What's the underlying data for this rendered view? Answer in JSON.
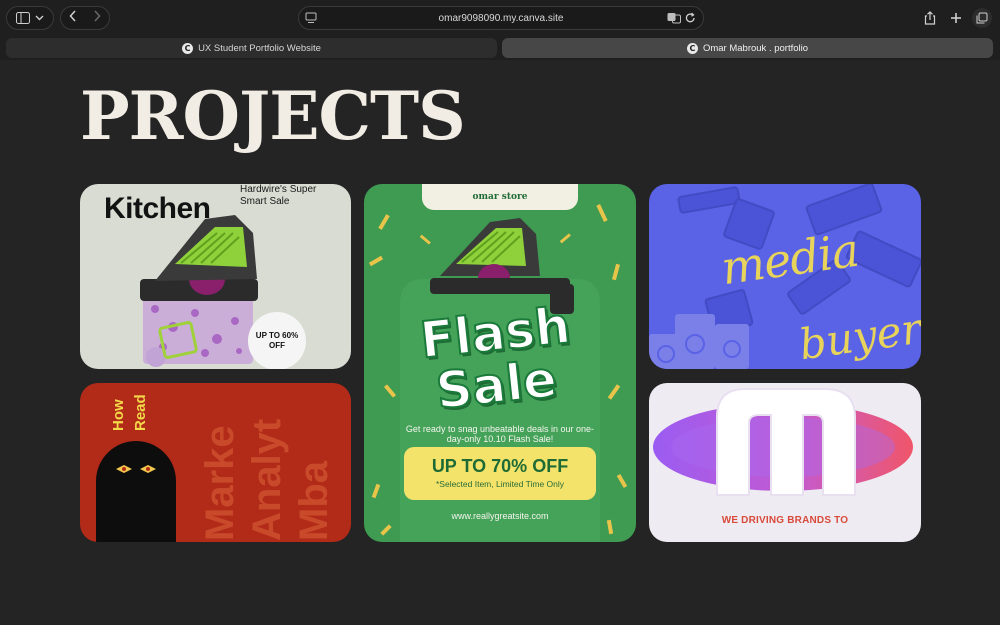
{
  "browser": {
    "url": "omar9098090.my.canva.site",
    "tabs": [
      {
        "label": "UX Student Portfolio Website",
        "active": false
      },
      {
        "label": "Omar Mabrouk . portfolio",
        "active": true
      }
    ]
  },
  "page": {
    "title": "PROJECTS"
  },
  "projects": {
    "kitchen": {
      "title": "Kitchen",
      "subtitle": "Hardwire's Super Smart Sale",
      "badge": "UP TO 60% OFF"
    },
    "howto": {
      "words_yellow": [
        "How",
        "Read"
      ],
      "words_red": [
        "Marke",
        "Analyt",
        "Mba"
      ]
    },
    "flash": {
      "store": "omar store",
      "word1": "Flash",
      "word2": "Sale",
      "description": "Get ready to snag unbeatable deals in our one-day-only 10.10 Flash Sale!",
      "deal": "UP TO 70% OFF",
      "deal_note": "*Selected Item, Limited Time Only",
      "site": "www.reallygreatsite.com"
    },
    "media": {
      "word1": "media",
      "word2": "buyer"
    },
    "brand": {
      "tagline": "WE DRIVING BRANDS TO"
    }
  },
  "colors": {
    "background": "#242424",
    "flash_green": "#3f9a52",
    "media_blue": "#5a62e6",
    "howto_red": "#b22a18",
    "brand_purple": "#a86cf0"
  }
}
